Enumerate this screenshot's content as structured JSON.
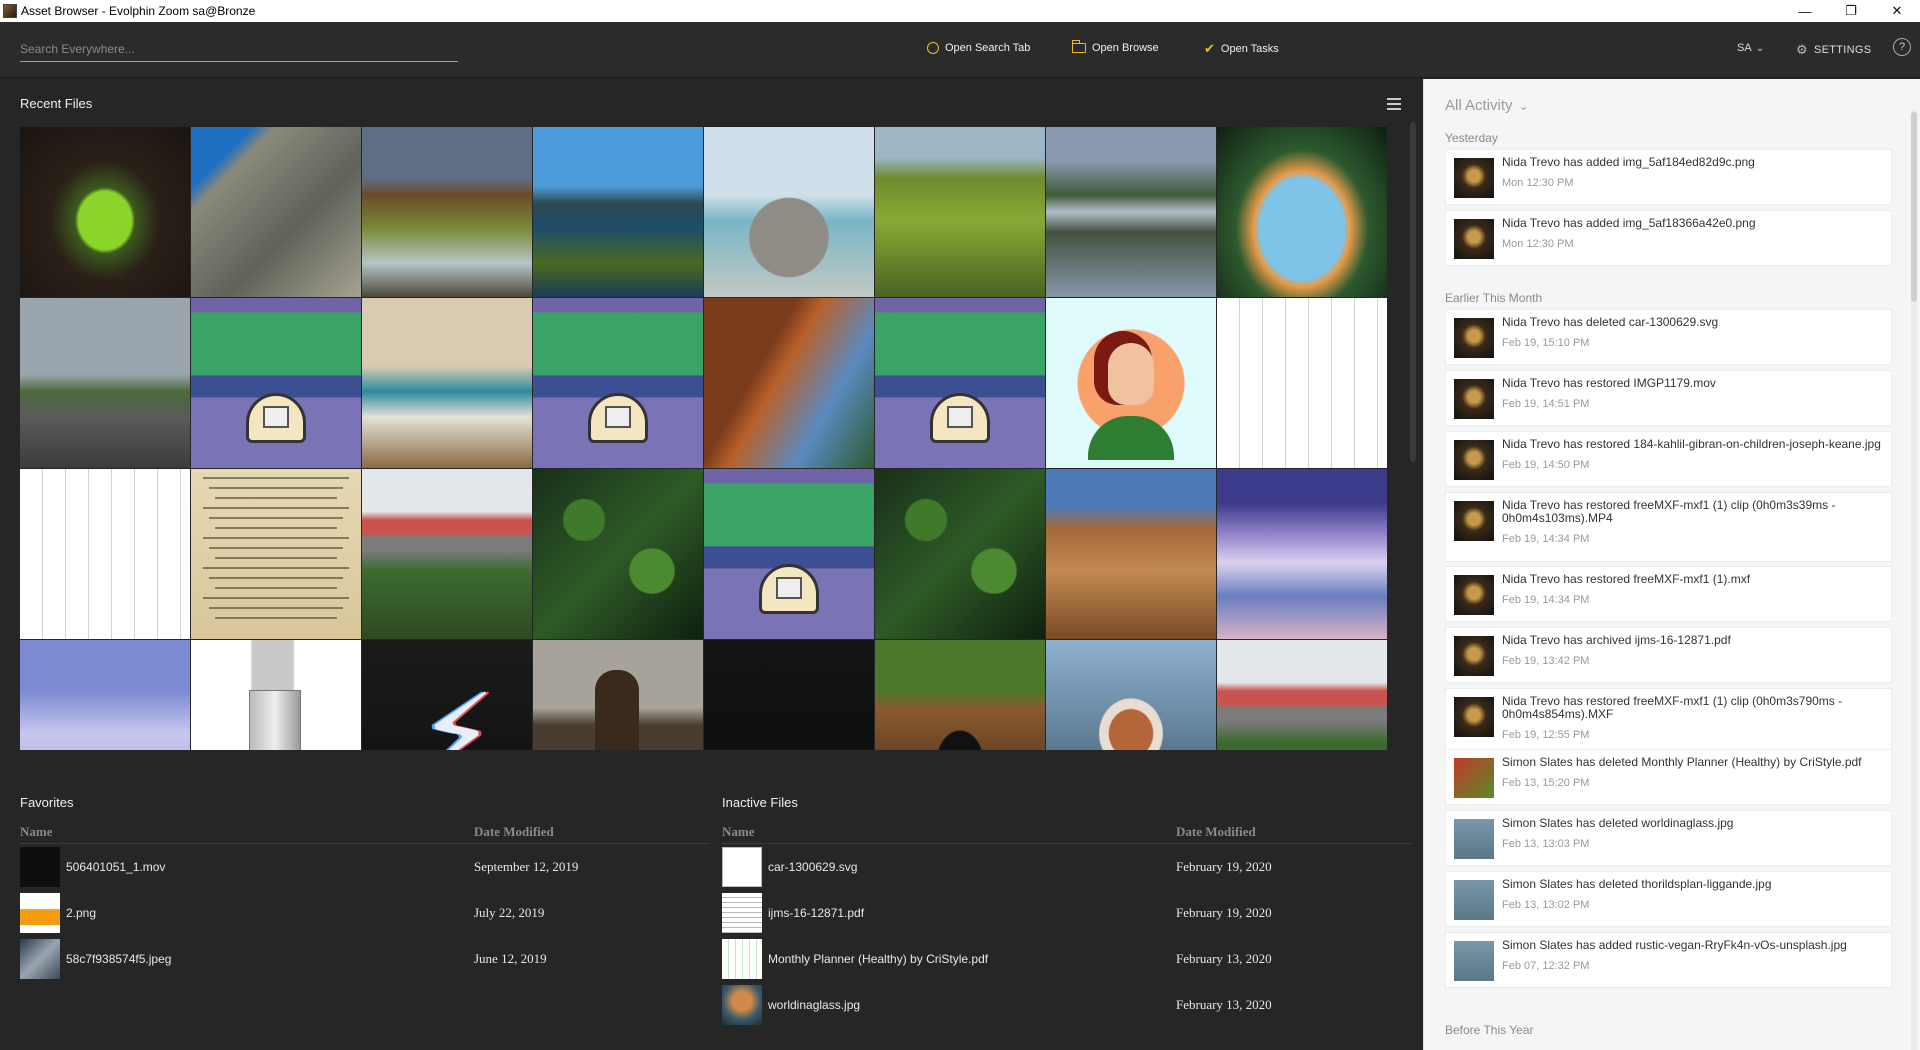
{
  "window": {
    "title": "Asset Browser - Evolphin Zoom sa@Bronze",
    "minimize": "—",
    "maximize": "❐",
    "close": "✕"
  },
  "topbar": {
    "search_placeholder": "Search Everywhere...",
    "open_search_tab": "Open Search Tab",
    "open_browse": "Open Browse",
    "open_tasks": "Open Tasks",
    "user": "SA",
    "settings": "SETTINGS",
    "help": "?",
    "accent_color": "#e6c02e"
  },
  "recent": {
    "title": "Recent Files",
    "tiles": [
      {
        "kind": "green-pool"
      },
      {
        "kind": "sea-cliff"
      },
      {
        "kind": "mountain-waterfall"
      },
      {
        "kind": "sea-rock"
      },
      {
        "kind": "glacier-boulder"
      },
      {
        "kind": "moss-field"
      },
      {
        "kind": "lake-reflection"
      },
      {
        "kind": "cave-waterfall"
      },
      {
        "kind": "highway"
      },
      {
        "kind": "mxf-logo"
      },
      {
        "kind": "blanket-room"
      },
      {
        "kind": "mxf-logo"
      },
      {
        "kind": "tall-building"
      },
      {
        "kind": "mxf-logo"
      },
      {
        "kind": "avatar"
      },
      {
        "kind": "planner"
      },
      {
        "kind": "planner"
      },
      {
        "kind": "poem-page"
      },
      {
        "kind": "covered-bridge-red"
      },
      {
        "kind": "forest-aerial"
      },
      {
        "kind": "mxf-logo"
      },
      {
        "kind": "forest-aerial"
      },
      {
        "kind": "canyon-road"
      },
      {
        "kind": "purple-clouds"
      },
      {
        "kind": "sky-clouds"
      },
      {
        "kind": "server"
      },
      {
        "kind": "lightning"
      },
      {
        "kind": "okapi"
      },
      {
        "kind": "dark"
      },
      {
        "kind": "wooden-bridge"
      },
      {
        "kind": "squirrel"
      },
      {
        "kind": "covered-bridge-red"
      }
    ]
  },
  "favorites": {
    "title": "Favorites",
    "col_name": "Name",
    "col_date": "Date Modified",
    "rows": [
      {
        "name": "506401051_1.mov",
        "date": "September 12, 2019",
        "thumb": "dark"
      },
      {
        "name": "2.png",
        "date": "July 22, 2019",
        "thumb": "vlc"
      },
      {
        "name": "58c7f938574f5.jpeg",
        "date": "June 12, 2019",
        "thumb": "building"
      }
    ]
  },
  "inactive": {
    "title": "Inactive Files",
    "col_name": "Name",
    "col_date": "Date Modified",
    "rows": [
      {
        "name": "car-1300629.svg",
        "date": "February 19, 2020",
        "thumb": "blank"
      },
      {
        "name": "ijms-16-12871.pdf",
        "date": "February 19, 2020",
        "thumb": "doc"
      },
      {
        "name": "Monthly Planner (Healthy) by CriStyle.pdf",
        "date": "February 13, 2020",
        "thumb": "planner"
      },
      {
        "name": "worldinaglass.jpg",
        "date": "February 13, 2020",
        "thumb": "glass"
      }
    ]
  },
  "activity": {
    "filter": "All Activity",
    "groups": [
      {
        "label": "Yesterday"
      },
      {
        "label": "Earlier This Month"
      },
      {
        "label": "Before This Year"
      }
    ],
    "items": [
      {
        "msg": "Nida Trevo has added img_5af184ed82d9c.png",
        "time": "Mon 12:30 PM",
        "thumb": "avatar-dark"
      },
      {
        "msg": "Nida Trevo has added img_5af18366a42e0.png",
        "time": "Mon 12:30 PM",
        "thumb": "avatar-dark"
      },
      {
        "msg": "Nida Trevo has deleted car-1300629.svg",
        "time": "Feb 19, 15:10 PM",
        "thumb": "avatar-dark"
      },
      {
        "msg": "Nida Trevo has restored IMGP1179.mov",
        "time": "Feb 19, 14:51 PM",
        "thumb": "avatar-dark"
      },
      {
        "msg": "Nida Trevo has restored 184-kahlil-gibran-on-children-joseph-keane.jpg",
        "time": "Feb 19, 14:50 PM",
        "thumb": "avatar-dark"
      },
      {
        "msg": "Nida Trevo has restored freeMXF-mxf1 (1) clip (0h0m3s39ms - 0h0m4s103ms).MP4",
        "time": "Feb 19, 14:34 PM",
        "thumb": "avatar-dark"
      },
      {
        "msg": "Nida Trevo has restored freeMXF-mxf1 (1).mxf",
        "time": "Feb 19, 14:34 PM",
        "thumb": "avatar-dark"
      },
      {
        "msg": "Nida Trevo has archived ijms-16-12871.pdf",
        "time": "Feb 19, 13:42 PM",
        "thumb": "avatar-dark"
      },
      {
        "msg": "Nida Trevo has restored freeMXF-mxf1 (1) clip (0h0m3s790ms - 0h0m4s854ms).MXF",
        "time": "Feb 19, 12:55 PM",
        "thumb": "avatar-dark"
      },
      {
        "msg": "Simon Slates has deleted Monthly Planner (Healthy) by CriStyle.pdf",
        "time": "Feb 13, 15:20 PM",
        "thumb": "avatar-red"
      },
      {
        "msg": "Simon Slates has deleted worldinaglass.jpg",
        "time": "Feb 13, 13:03 PM",
        "thumb": "avatar-blue"
      },
      {
        "msg": "Simon Slates has deleted thorildsplan-liggande.jpg",
        "time": "Feb 13, 13:02 PM",
        "thumb": "avatar-blue"
      },
      {
        "msg": "Simon Slates has added rustic-vegan-RryFk4n-vOs-unsplash.jpg",
        "time": "Feb 07, 12:32 PM",
        "thumb": "avatar-blue"
      }
    ]
  }
}
